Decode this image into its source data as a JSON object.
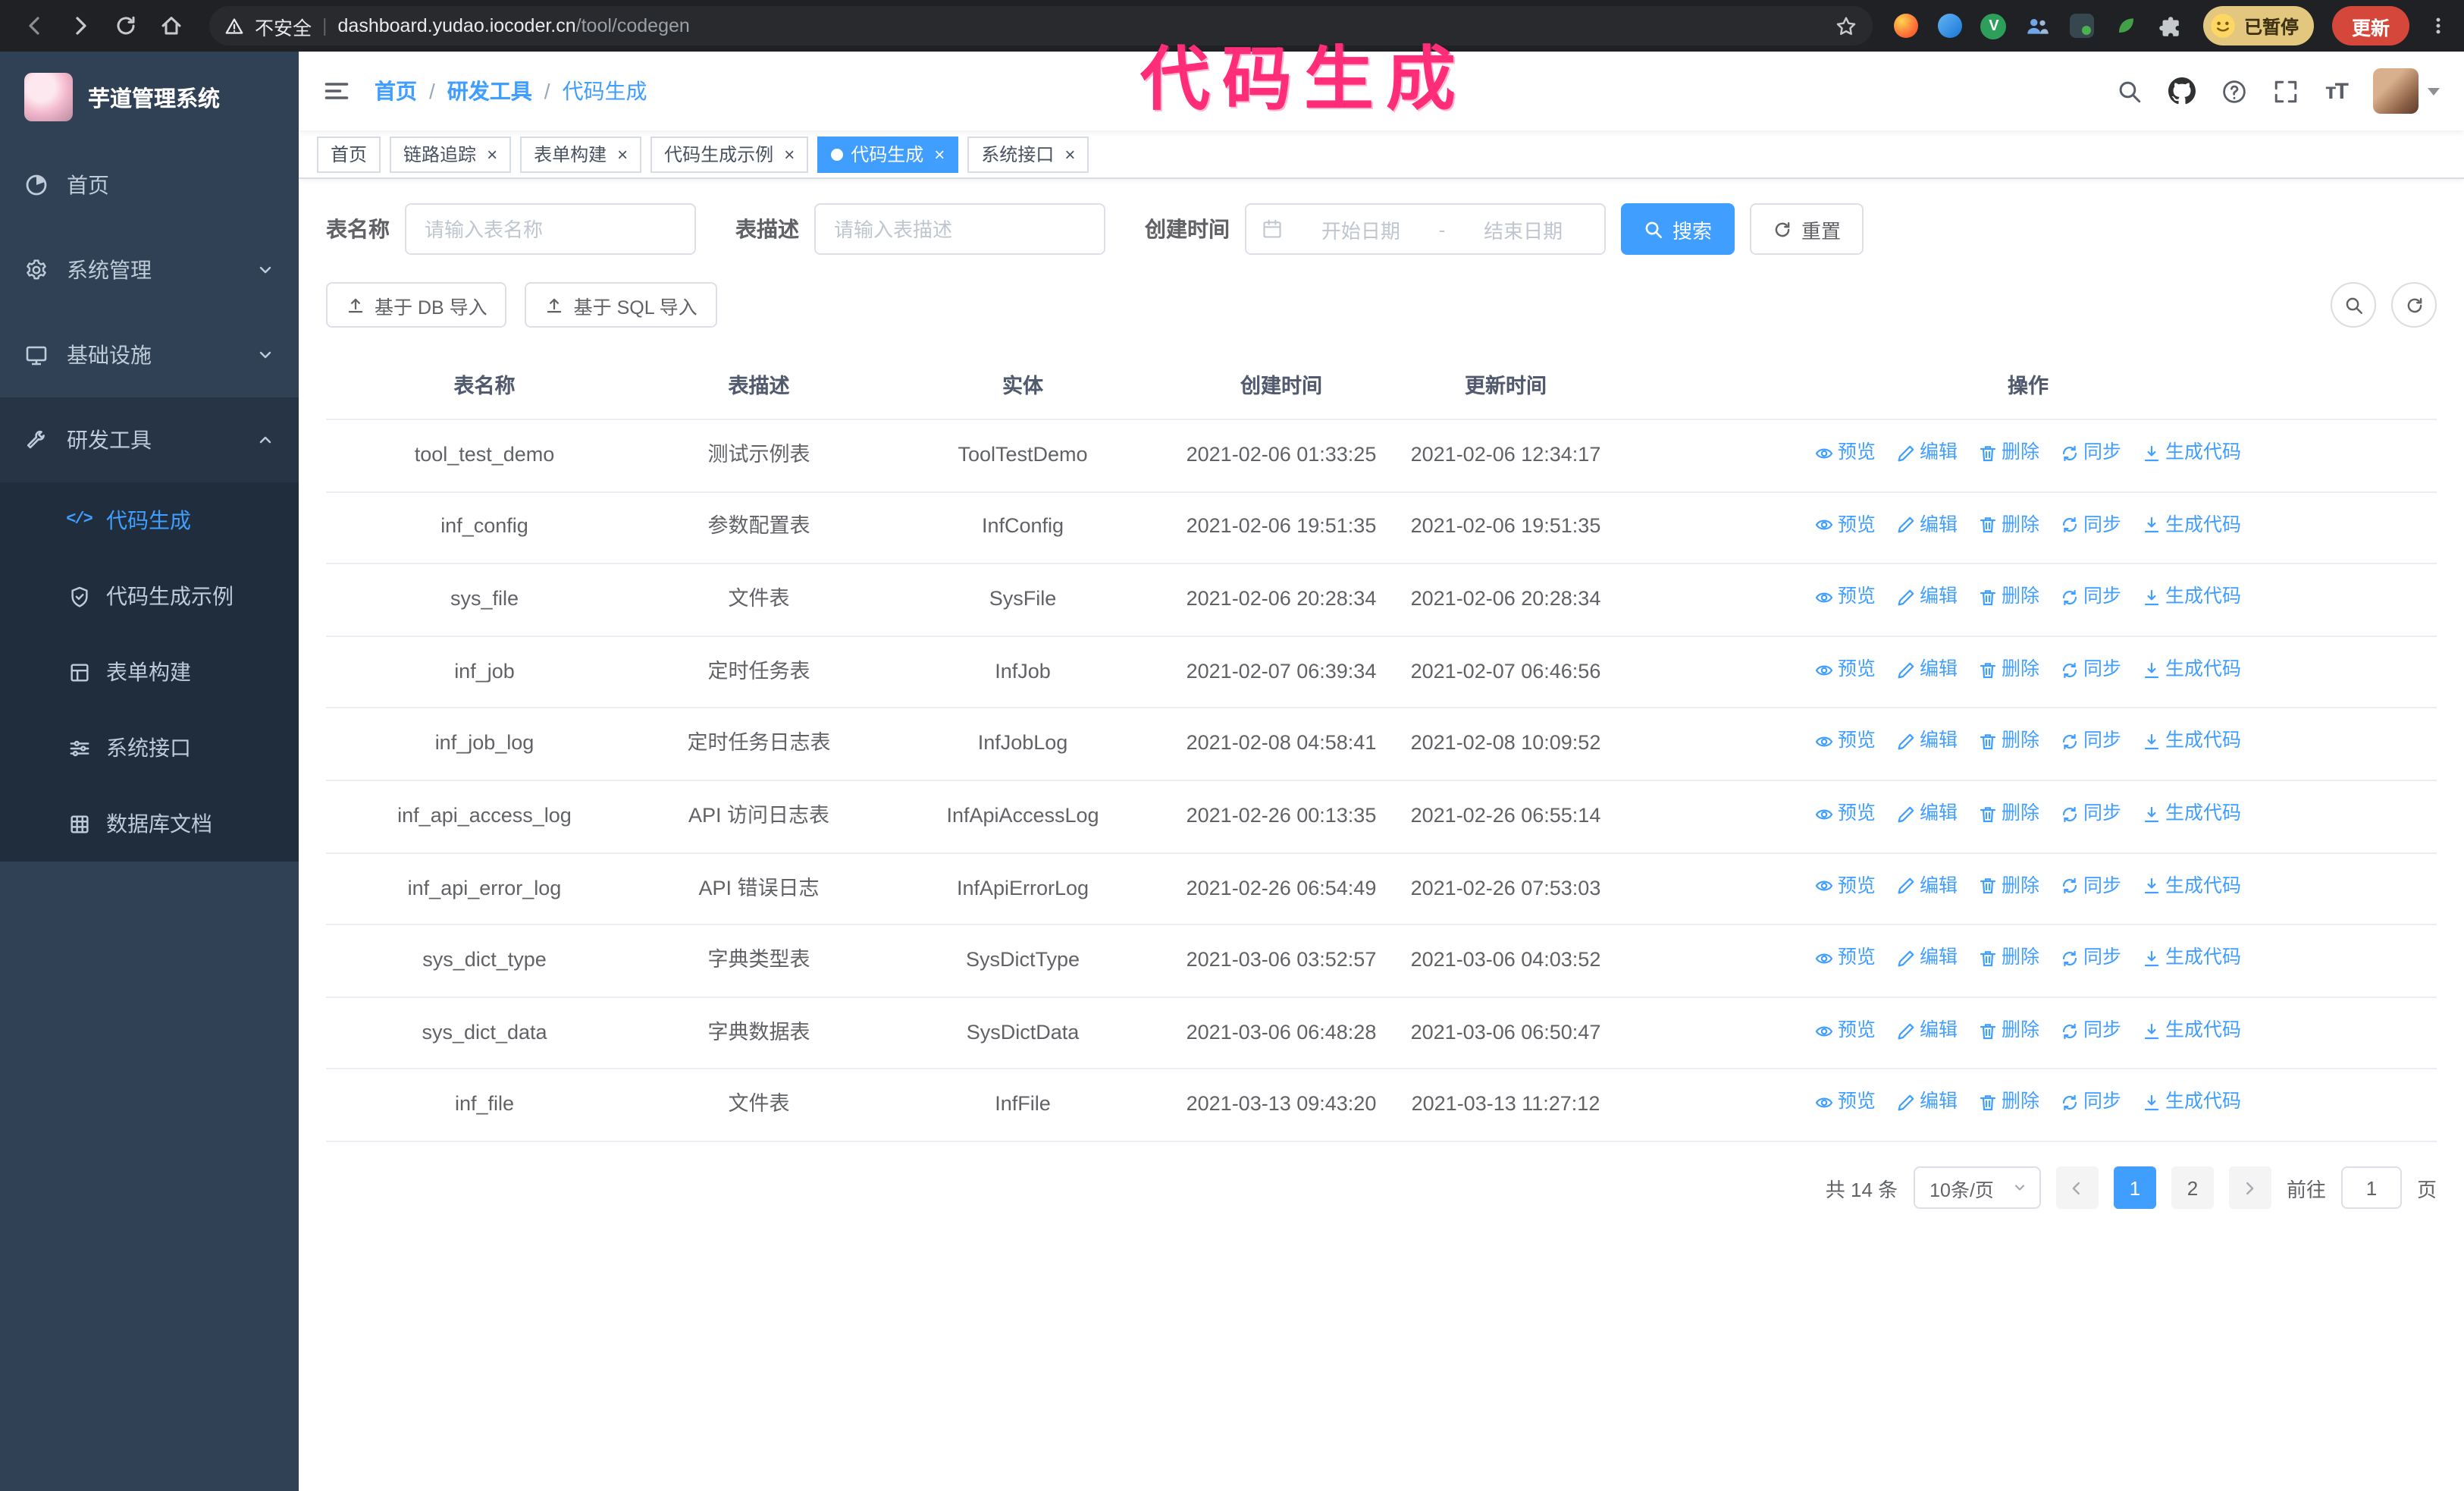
{
  "colors": {
    "accent": "#409eff",
    "sidebar_bg": "#304156",
    "sidebar_submenu_bg": "#1f2d3d",
    "annotation": "#ff2d78",
    "update_button_bg": "#d5473a",
    "paused_badge_bg": "#e3c77f"
  },
  "browser": {
    "security_label": "不安全",
    "url_host": "dashboard.yudao.iocoder.cn",
    "url_path": "/tool/codegen",
    "paused_badge": "已暂停",
    "update_button": "更新"
  },
  "annotation": {
    "text": "代码生成"
  },
  "sidebar": {
    "logo_title": "芋道管理系统",
    "items": [
      {
        "label": "首页"
      },
      {
        "label": "系统管理"
      },
      {
        "label": "基础设施"
      },
      {
        "label": "研发工具",
        "children": [
          {
            "label": "代码生成"
          },
          {
            "label": "代码生成示例"
          },
          {
            "label": "表单构建"
          },
          {
            "label": "系统接口"
          },
          {
            "label": "数据库文档"
          }
        ]
      }
    ]
  },
  "header": {
    "breadcrumb": [
      "首页",
      "研发工具",
      "代码生成"
    ],
    "separator": "/"
  },
  "tabs": [
    {
      "label": "首页"
    },
    {
      "label": "链路追踪"
    },
    {
      "label": "表单构建"
    },
    {
      "label": "代码生成示例"
    },
    {
      "label": "代码生成"
    },
    {
      "label": "系统接口"
    }
  ],
  "filters": {
    "table_name_label": "表名称",
    "table_name_placeholder": "请输入表名称",
    "table_desc_label": "表描述",
    "table_desc_placeholder": "请输入表描述",
    "create_time_label": "创建时间",
    "date_start_placeholder": "开始日期",
    "date_separator": "-",
    "date_end_placeholder": "结束日期",
    "search_button": "搜索",
    "reset_button": "重置"
  },
  "toolbar": {
    "import_db": "基于 DB 导入",
    "import_sql": "基于 SQL 导入"
  },
  "table": {
    "columns": [
      "表名称",
      "表描述",
      "实体",
      "创建时间",
      "更新时间",
      "操作"
    ],
    "actions": [
      "预览",
      "编辑",
      "删除",
      "同步",
      "生成代码"
    ],
    "rows": [
      {
        "name": "tool_test_demo",
        "desc": "测试示例表",
        "entity": "ToolTestDemo",
        "created": "2021-02-06 01:33:25",
        "updated": "2021-02-06 12:34:17"
      },
      {
        "name": "inf_config",
        "desc": "参数配置表",
        "entity": "InfConfig",
        "created": "2021-02-06 19:51:35",
        "updated": "2021-02-06 19:51:35"
      },
      {
        "name": "sys_file",
        "desc": "文件表",
        "entity": "SysFile",
        "created": "2021-02-06 20:28:34",
        "updated": "2021-02-06 20:28:34"
      },
      {
        "name": "inf_job",
        "desc": "定时任务表",
        "entity": "InfJob",
        "created": "2021-02-07 06:39:34",
        "updated": "2021-02-07 06:46:56"
      },
      {
        "name": "inf_job_log",
        "desc": "定时任务日志表",
        "entity": "InfJobLog",
        "created": "2021-02-08 04:58:41",
        "updated": "2021-02-08 10:09:52"
      },
      {
        "name": "inf_api_access_log",
        "desc": "API 访问日志表",
        "entity": "InfApiAccessLog",
        "created": "2021-02-26 00:13:35",
        "updated": "2021-02-26 06:55:14"
      },
      {
        "name": "inf_api_error_log",
        "desc": "API 错误日志",
        "entity": "InfApiErrorLog",
        "created": "2021-02-26 06:54:49",
        "updated": "2021-02-26 07:53:03"
      },
      {
        "name": "sys_dict_type",
        "desc": "字典类型表",
        "entity": "SysDictType",
        "created": "2021-03-06 03:52:57",
        "updated": "2021-03-06 04:03:52"
      },
      {
        "name": "sys_dict_data",
        "desc": "字典数据表",
        "entity": "SysDictData",
        "created": "2021-03-06 06:48:28",
        "updated": "2021-03-06 06:50:47"
      },
      {
        "name": "inf_file",
        "desc": "文件表",
        "entity": "InfFile",
        "created": "2021-03-13 09:43:20",
        "updated": "2021-03-13 11:27:12"
      }
    ]
  },
  "pagination": {
    "total": "共 14 条",
    "page_size": "10条/页",
    "pages": [
      "1",
      "2"
    ],
    "active_page": "1",
    "goto_label": "前往",
    "goto_value": "1",
    "goto_unit": "页"
  }
}
